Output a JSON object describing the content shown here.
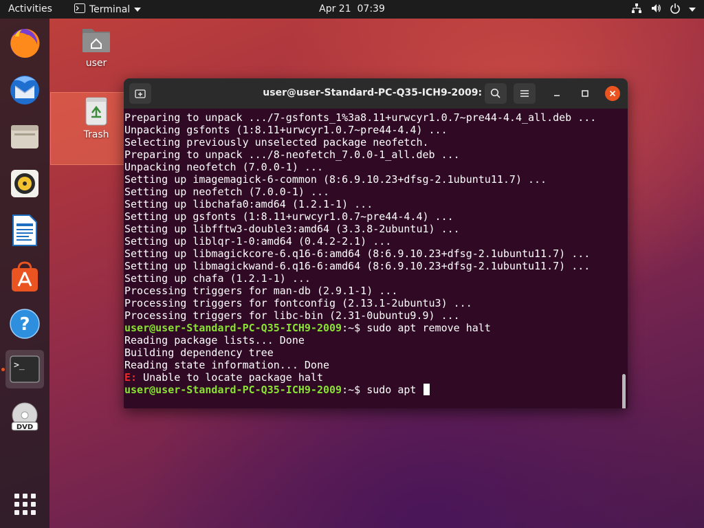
{
  "topbar": {
    "activities": "Activities",
    "app_name": "Terminal",
    "date": "Apr 21",
    "time": "07:39",
    "tray": [
      "network-icon",
      "volume-icon",
      "power-icon"
    ]
  },
  "dock": {
    "items": [
      "firefox",
      "thunderbird",
      "files",
      "rhythmbox",
      "libreoffice-writer",
      "ubuntu-software",
      "help",
      "terminal",
      "dvd"
    ],
    "active": "terminal",
    "apps_grid": "show-applications"
  },
  "desktop": {
    "icons": [
      {
        "label": "user"
      },
      {
        "label": "Trash"
      }
    ]
  },
  "terminal": {
    "title": "user@user-Standard-PC-Q35-ICH9-2009: ~",
    "prompt": "user@user-Standard-PC-Q35-ICH9-2009",
    "prompt_suffix": ":~$ ",
    "lines": [
      "Preparing to unpack .../7-gsfonts_1%3a8.11+urwcyr1.0.7~pre44-4.4_all.deb ...",
      "Unpacking gsfonts (1:8.11+urwcyr1.0.7~pre44-4.4) ...",
      "Selecting previously unselected package neofetch.",
      "Preparing to unpack .../8-neofetch_7.0.0-1_all.deb ...",
      "Unpacking neofetch (7.0.0-1) ...",
      "Setting up imagemagick-6-common (8:6.9.10.23+dfsg-2.1ubuntu11.7) ...",
      "Setting up neofetch (7.0.0-1) ...",
      "Setting up libchafa0:amd64 (1.2.1-1) ...",
      "Setting up gsfonts (1:8.11+urwcyr1.0.7~pre44-4.4) ...",
      "Setting up libfftw3-double3:amd64 (3.3.8-2ubuntu1) ...",
      "Setting up liblqr-1-0:amd64 (0.4.2-2.1) ...",
      "Setting up libmagickcore-6.q16-6:amd64 (8:6.9.10.23+dfsg-2.1ubuntu11.7) ...",
      "Setting up libmagickwand-6.q16-6:amd64 (8:6.9.10.23+dfsg-2.1ubuntu11.7) ...",
      "Setting up chafa (1.2.1-1) ...",
      "Processing triggers for man-db (2.9.1-1) ...",
      "Processing triggers for fontconfig (2.13.1-2ubuntu3) ...",
      "Processing triggers for libc-bin (2.31-0ubuntu9.9) ..."
    ],
    "command1": "sudo apt remove halt",
    "output": [
      "Reading package lists... Done",
      "Building dependency tree",
      "Reading state information... Done"
    ],
    "error_prefix": "E:",
    "error_text": " Unable to locate package halt",
    "current_input": "sudo apt "
  },
  "colors": {
    "terminal_bg": "#300a24",
    "prompt": "#8ae234",
    "error": "#ef2929",
    "accent": "#e95420"
  }
}
